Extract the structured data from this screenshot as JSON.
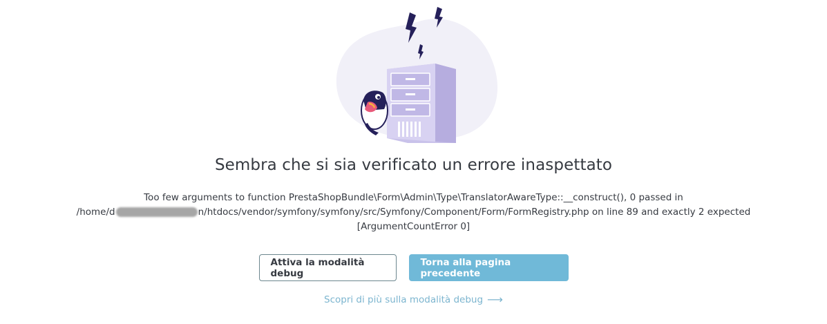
{
  "error": {
    "title": "Sembra che si sia verificato un errore inaspettato",
    "message_line1": "Too few arguments to function PrestaShopBundle\\Form\\Admin\\Type\\TranslatorAwareType::__construct(), 0 passed in",
    "message_line2_prefix": "/home/d",
    "message_line2_suffix": "n/htdocs/vendor/symfony/symfony/src/Symfony/Component/Form/FormRegistry.php on line 89 and exactly 2 expected",
    "message_line3": "[ArgumentCountError 0]"
  },
  "actions": {
    "debug_button_label": "Attiva la modalità debug",
    "back_button_label": "Torna alla pagina precedente",
    "learn_more_label": "Scopri di più sulla modalità debug",
    "learn_more_arrow": "⟶"
  },
  "colors": {
    "primary": "#70b9d8",
    "link": "#7cb5cf",
    "text": "#363a41",
    "illustration_blob": "#f1f0f8",
    "server": "#c7c0e8",
    "lightning": "#25205a"
  },
  "icons": {
    "illustration": "server-error-illustration",
    "mascot": "puffin-mascot",
    "lightning": "lightning-bolt-icon",
    "arrow": "arrow-right-icon"
  }
}
